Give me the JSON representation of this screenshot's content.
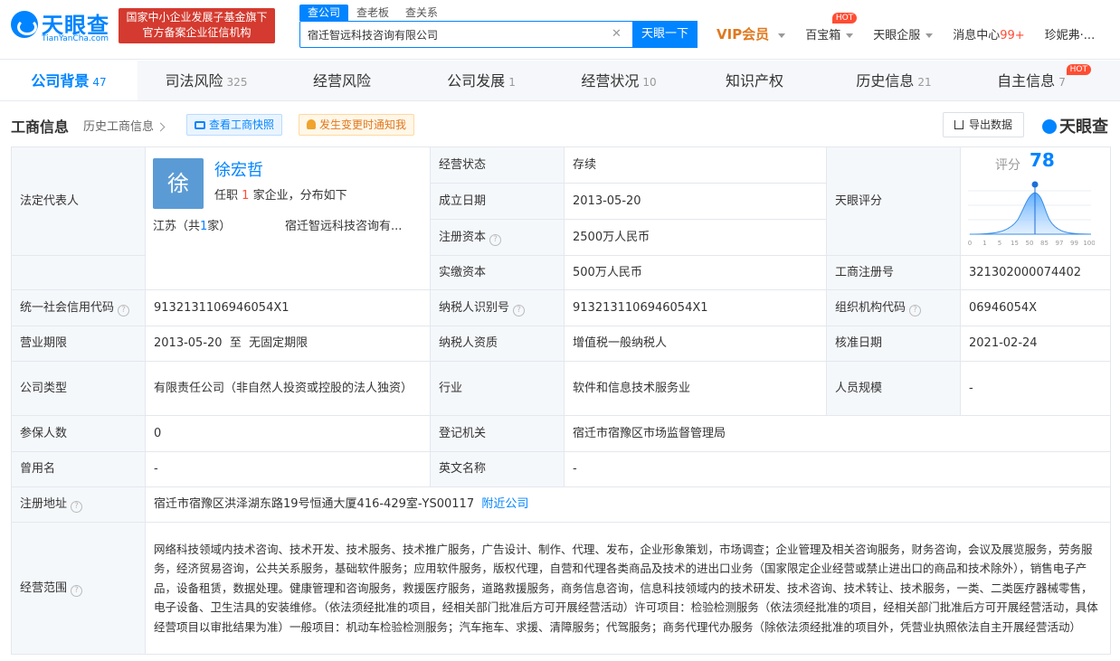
{
  "header": {
    "logo_text": "天眼查",
    "logo_sub": "TianYanCha.com",
    "fund_banner_line1": "国家中小企业发展子基金旗下",
    "fund_banner_line2": "官方备案企业征信机构",
    "search_tabs": [
      "查公司",
      "查老板",
      "查关系"
    ],
    "search_value": "宿迁智远科技咨询有限公司",
    "search_btn": "天眼一下",
    "vip": "VIP会员",
    "nav": {
      "treasure": "百宝箱",
      "hot": "HOT",
      "enterprise": "天眼企服",
      "messages": "消息中心",
      "messages_count": "99+",
      "user": "珍妮弗·..."
    }
  },
  "tabs": [
    {
      "label": "公司背景",
      "count": "47"
    },
    {
      "label": "司法风险",
      "count": "325"
    },
    {
      "label": "经营风险",
      "count": ""
    },
    {
      "label": "公司发展",
      "count": "1"
    },
    {
      "label": "经营状况",
      "count": "10"
    },
    {
      "label": "知识产权",
      "count": ""
    },
    {
      "label": "历史信息",
      "count": "21"
    },
    {
      "label": "自主信息",
      "count": "7"
    }
  ],
  "tab_hot": "HOT",
  "section": {
    "title": "工商信息",
    "history": "历史工商信息",
    "snapshot": "查看工商快照",
    "notify": "发生变更时通知我",
    "export": "导出数据",
    "brand": "天眼查"
  },
  "legal": {
    "label": "法定代表人",
    "avatar": "徐",
    "name": "徐宏哲",
    "role_pre": "任职",
    "role_num": "1",
    "role_post": "家企业，分布如下",
    "region_pre": "江苏（共",
    "region_num": "1",
    "region_post": "家）",
    "company": "宿迁智远科技咨询有..."
  },
  "score": {
    "label": "天眼评分",
    "score_text": "评分",
    "value": 78,
    "ticks": [
      "0",
      "1",
      "5",
      "15",
      "50",
      "85",
      "97",
      "99",
      "100"
    ]
  },
  "fields": {
    "status_l": "经营状态",
    "status_v": "存续",
    "found_l": "成立日期",
    "found_v": "2013-05-20",
    "capital_l": "注册资本",
    "capital_v": "2500万人民币",
    "paid_l": "实缴资本",
    "paid_v": "500万人民币",
    "regno_l": "工商注册号",
    "regno_v": "321302000074402",
    "credit_l": "统一社会信用代码",
    "credit_v": "9132131106946054X1",
    "taxid_l": "纳税人识别号",
    "taxid_v": "9132131106946054X1",
    "org_l": "组织机构代码",
    "org_v": "06946054X",
    "term_l": "营业期限",
    "term_v": "2013-05-20  至  无固定期限",
    "taxq_l": "纳税人资质",
    "taxq_v": "增值税一般纳税人",
    "approve_l": "核准日期",
    "approve_v": "2021-02-24",
    "type_l": "公司类型",
    "type_v": "有限责任公司（非自然人投资或控股的法人独资）",
    "industry_l": "行业",
    "industry_v": "软件和信息技术服务业",
    "staff_l": "人员规模",
    "staff_v": "-",
    "insured_l": "参保人数",
    "insured_v": "0",
    "authority_l": "登记机关",
    "authority_v": "宿迁市宿豫区市场监督管理局",
    "former_l": "曾用名",
    "former_v": "-",
    "english_l": "英文名称",
    "english_v": "-",
    "address_l": "注册地址",
    "address_v": "宿迁市宿豫区洪泽湖东路19号恒通大厦416-429室-YS00117",
    "address_link": "附近公司",
    "scope_l": "经营范围",
    "scope_v": "网络科技领域内技术咨询、技术开发、技术服务、技术推广服务，广告设计、制作、代理、发布，企业形象策划，市场调查；企业管理及相关咨询服务，财务咨询，会议及展览服务，劳务服务，经济贸易咨询，公共关系服务，基础软件服务；应用软件服务，版权代理，自营和代理各类商品及技术的进出口业务（国家限定企业经营或禁止进出口的商品和技术除外），销售电子产品，设备租赁，数据处理。健康管理和咨询服务，救援医疗服务，道路救援服务，商务信息咨询，信息科技领域内的技术研发、技术咨询、技术转让、技术服务，一类、二类医疗器械零售，电子设备、卫生洁具的安装维修。（依法须经批准的项目，经相关部门批准后方可开展经营活动）许可项目：检验检测服务（依法须经批准的项目，经相关部门批准后方可开展经营活动，具体经营项目以审批结果为准）一般项目：机动车检验检测服务；汽车拖车、求援、清障服务；代驾服务；商务代理代办服务（除依法须经批准的项目外，凭营业执照依法自主开展经营活动）"
  },
  "colors": {
    "accent": "#0084ff",
    "hot": "#ff4d33",
    "vip": "#e0791f"
  }
}
